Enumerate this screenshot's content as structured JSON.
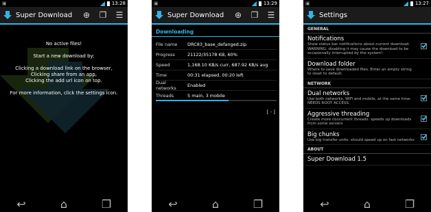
{
  "status": {
    "time1": "13:28",
    "time2": "13:29",
    "time3": "13:27"
  },
  "panel1": {
    "title": "Super Download",
    "lines": [
      "No active files!",
      "Start a new download by:",
      "Clicking a download link on the browser,",
      "Clicking share from an app,",
      "Clicking the add url icon on top.",
      "For more information, click the settings icon."
    ]
  },
  "panel2": {
    "title": "Super Download",
    "section": "Downloading",
    "rows": [
      {
        "k": "File name",
        "v": "DRC83_base_defanged.zip"
      },
      {
        "k": "Progress",
        "v": "21122/35178 KB, 60%"
      },
      {
        "k": "Speed",
        "v": "1,168.10 KB/s curr, 687.92 KB/s avg"
      },
      {
        "k": "Time",
        "v": "00:31 elapsed, 00:20 left"
      },
      {
        "k": "Dual networks",
        "v": "Enabled"
      },
      {
        "k": "Threads",
        "v": "5 main, 3 mobile"
      }
    ],
    "progress_fraction": 0.6,
    "collapse_label": "[ - ]"
  },
  "panel3": {
    "title": "Settings",
    "general": "GENERAL",
    "notifications": {
      "title": "Notifications",
      "sub": "Show status bar notifications about current download. WARNING: disabling it may cause the download to be occasionally interrupted by the system!"
    },
    "folder": {
      "title": "Download folder",
      "sub": "Where to save downloaded files. Enter an empty string to reset to default."
    },
    "network": "NETWORK",
    "dual": {
      "title": "Dual networks",
      "sub": "Use both networks, WiFi and mobile, at the same time. NEEDS ROOT ACCESS."
    },
    "aggr": {
      "title": "Aggressive threading",
      "sub": "Create more concurrent threads: speeds up downloads from some servers"
    },
    "chunks": {
      "title": "Big chunks",
      "sub": "Use big transfer units: should speed up on fast networks"
    },
    "about": "ABOUT",
    "about_title": "Super Download 1.5"
  },
  "colors": {
    "accent": "#33b5e5",
    "bg": "#000000"
  }
}
